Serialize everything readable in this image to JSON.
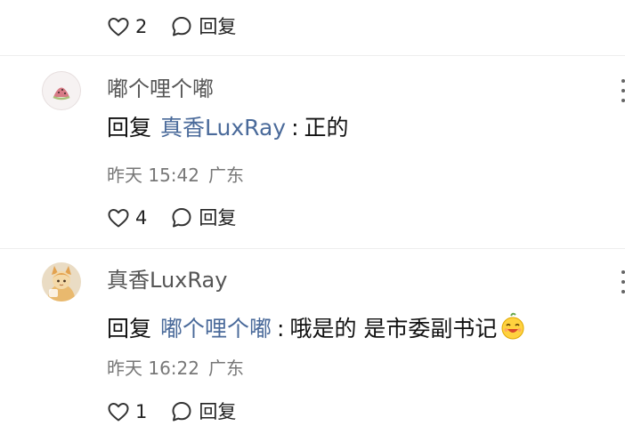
{
  "comments": [
    {
      "likes": "2",
      "reply_label": "回复"
    },
    {
      "username": "嘟个哩个嘟",
      "reply_prefix": "回复",
      "reply_target": "真香LuxRay",
      "separator": ":",
      "text": "正的",
      "time": "昨天 15:42",
      "location": "广东",
      "likes": "4",
      "reply_label": "回复"
    },
    {
      "username": "真香LuxRay",
      "reply_prefix": "回复",
      "reply_target": "嘟个哩个嘟",
      "separator": ":",
      "text": "哦是的 是市委副书记",
      "time": "昨天 16:22",
      "location": "广东",
      "likes": "1",
      "reply_label": "回复"
    }
  ],
  "icons": {
    "like": "heart-icon",
    "reply": "speech-bubble-icon",
    "more": "more-vertical-icon",
    "emoji": "laughing-emoji"
  },
  "colors": {
    "reply_target": "#4a6a9a",
    "meta": "#777777",
    "username": "#555555"
  }
}
